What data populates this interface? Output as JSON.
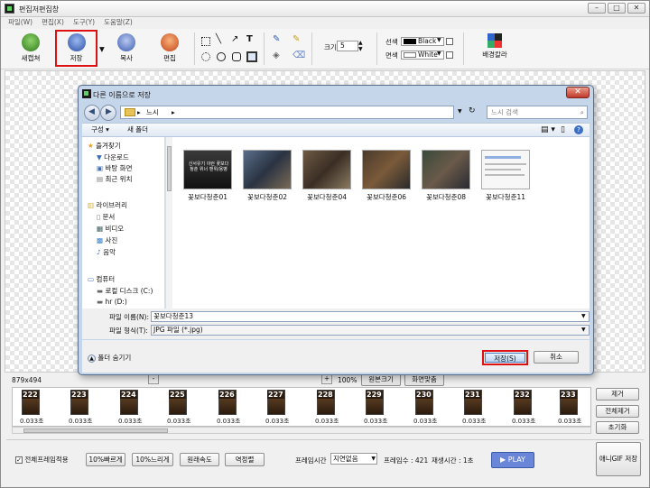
{
  "window": {
    "title": "편집저편집창"
  },
  "menu": [
    "파일(W)",
    "편집(X)",
    "도구(Y)",
    "도움말(Z)"
  ],
  "toolbar": {
    "new_label": "새캡쳐",
    "save_label": "저장",
    "copy_label": "복사",
    "edit_label": "편집",
    "size_label": "크기",
    "size_value": "5",
    "line_label": "선색",
    "line_color_name": "Black",
    "fill_label": "면색",
    "fill_color_name": "White",
    "bgcolor_label": "배경칼라",
    "accent": "#d11111"
  },
  "dialog": {
    "title": "다른 이름으로 저장",
    "path": "느시",
    "search_placeholder": "느시 검색",
    "organize_label": "구성 ▾",
    "newfolder_label": "새 폴더",
    "nav": {
      "favorites": "즐겨찾기",
      "downloads": "다운로드",
      "desktop": "바탕 화면",
      "recent": "최근 위치",
      "libraries": "라이브러리",
      "documents": "문서",
      "videos": "비디오",
      "pictures": "사진",
      "music": "음악",
      "computer": "컴퓨터",
      "local_disk": "로컬 디스크 (C:)",
      "hr_drive": "hr (D:)"
    },
    "files": [
      {
        "name": "꽃보다청춘01",
        "caption": "신서유기 이런 꽃보다 청춘 위너 맨위/용병"
      },
      {
        "name": "꽃보다청춘02"
      },
      {
        "name": "꽃보다청춘04"
      },
      {
        "name": "꽃보다청춘06"
      },
      {
        "name": "꽃보다청춘08"
      },
      {
        "name": "꽃보다청춘11"
      }
    ],
    "filename_label": "파일 이름(N):",
    "filename_value": "꽃보다청춘13",
    "filetype_label": "파일 형식(T):",
    "filetype_value": "JPG 파일 (*.jpg)",
    "hide_folders_label": "폴더 숨기기",
    "save_label": "저장(S)",
    "cancel_label": "취소"
  },
  "strip": {
    "image_size": "879x494",
    "zoom": "100%",
    "original_size_label": "원본크기",
    "fit_label": "화면맞춤",
    "frames": [
      {
        "num": "222",
        "dur": "0.033초"
      },
      {
        "num": "223",
        "dur": "0.033초"
      },
      {
        "num": "224",
        "dur": "0.033초"
      },
      {
        "num": "225",
        "dur": "0.033초"
      },
      {
        "num": "226",
        "dur": "0.033초"
      },
      {
        "num": "227",
        "dur": "0.033초"
      },
      {
        "num": "228",
        "dur": "0.033초"
      },
      {
        "num": "229",
        "dur": "0.033초"
      },
      {
        "num": "230",
        "dur": "0.033초"
      },
      {
        "num": "231",
        "dur": "0.033초"
      },
      {
        "num": "232",
        "dur": "0.033초"
      },
      {
        "num": "233",
        "dur": "0.033초"
      }
    ],
    "remove_label": "제거",
    "remove_all_label": "전체제거",
    "reset_label": "초기화"
  },
  "bottom": {
    "apply_all_label": "전체프레임적용",
    "faster_label": "10%빠르게",
    "slower_label": "10%느리게",
    "original_speed_label": "원래속도",
    "reverse_label": "역정렬",
    "frame_time_label": "프레임시간",
    "frame_time_value": "지연없음",
    "frame_count_text": "프레임수 : 421",
    "play_time_text": "재생시간 : 1초",
    "play_label": "▶ PLAY",
    "gif_save_label": "애니GIF 저장"
  }
}
